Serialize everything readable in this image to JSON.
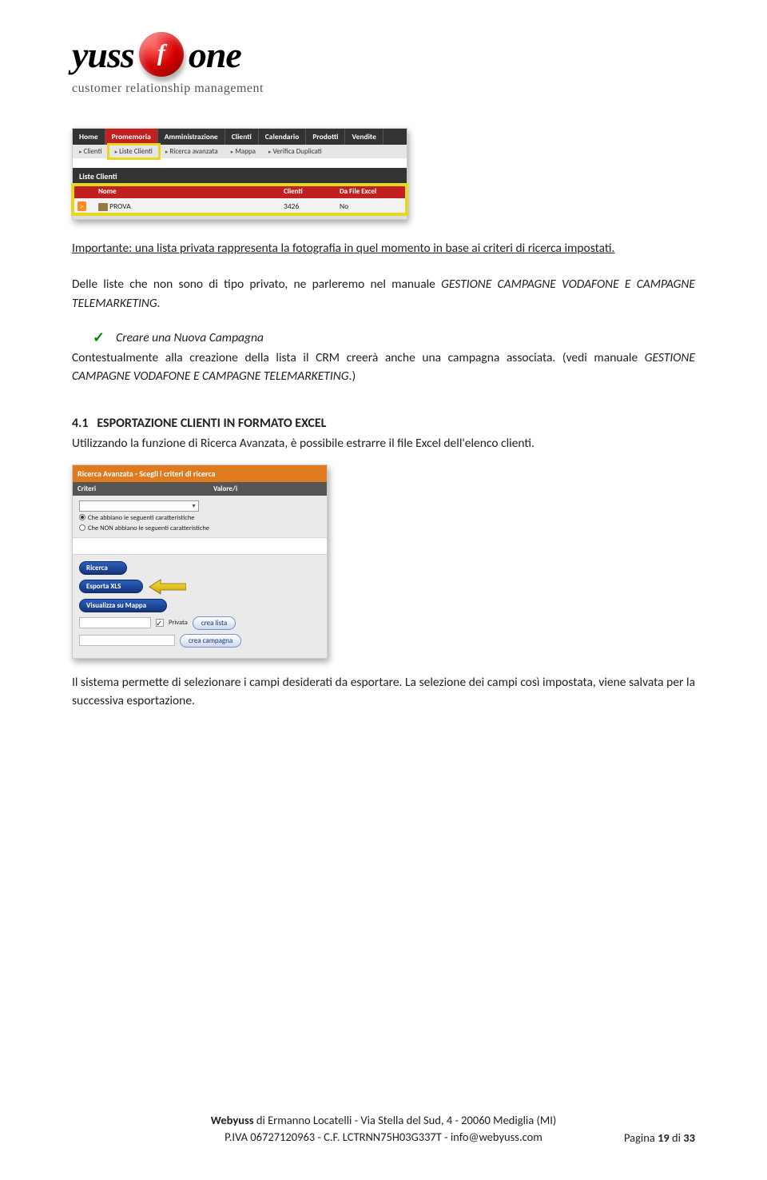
{
  "logo": {
    "word_before": "yuss",
    "word_after": "one",
    "tagline": "customer relationship management"
  },
  "shot1": {
    "nav1": [
      "Home",
      "Promemoria",
      "Amministrazione",
      "Clienti",
      "Calendario",
      "Prodotti",
      "Vendite"
    ],
    "nav1_active_index": 1,
    "nav2": [
      "Clienti",
      "Liste Clienti",
      "Ricerca avanzata",
      "Mappa",
      "Verifica Duplicati"
    ],
    "nav2_highlight_index": 1,
    "panel_title": "Liste Clienti",
    "columns": [
      "",
      "Nome",
      "Clienti",
      "Da File Excel"
    ],
    "row": {
      "chip": ">",
      "name": "PROVA",
      "clients": "3426",
      "from_excel": "No"
    }
  },
  "body": {
    "p1": "Importante: una lista privata rappresenta la fotografia in quel momento in base ai criteri di ricerca impostati.",
    "p2_a": "Delle liste che non sono di tipo privato, ne parleremo nel manuale ",
    "p2_b": "GESTIONE CAMPAGNE VODAFONE E CAMPAGNE TELEMARKETING.",
    "check_label": "Creare una Nuova Campagna",
    "p3_a": "Contestualmente alla creazione della lista il CRM creerà anche una campagna associata. (vedi manuale ",
    "p3_b": "GESTIONE CAMPAGNE VODAFONE E CAMPAGNE TELEMARKETING",
    "p3_c": ".)",
    "heading_num": "4.1",
    "heading_text": "ESPORTAZIONE CLIENTI IN FORMATO EXCEL",
    "p4": "Utilizzando la funzione di Ricerca Avanzata, è possibile estrarre il file Excel dell'elenco clienti.",
    "p5": "Il sistema permette di selezionare i campi desiderati da esportare. La selezione dei campi così impostata, viene salvata per la successiva esportazione."
  },
  "shot2": {
    "title": "Ricerca Avanzata - Scegli i criteri di ricerca",
    "col1": "Criteri",
    "col2": "Valore/i",
    "radio1": "Che abbiano le seguenti caratteristiche",
    "radio2": "Che NON abbiano le seguenti caratteristiche",
    "btn_ricerca": "Ricerca",
    "btn_esporta": "Esporta XLS",
    "btn_visualizza": "Visualizza su Mappa",
    "chk_privata": "Privata",
    "btn_crea_lista": "crea lista",
    "btn_crea_campagna": "crea campagna"
  },
  "footer": {
    "line1_a": "Webyuss",
    "line1_b": " di Ermanno Locatelli - Via Stella del Sud, 4 - 20060 Mediglia (MI)",
    "line2": "P.IVA 06727120963 - C.F. LCTRNN75H03G337T - info@webyuss.com",
    "page_label_a": "Pagina ",
    "page_current": "19",
    "page_label_b": " di ",
    "page_total": "33"
  }
}
